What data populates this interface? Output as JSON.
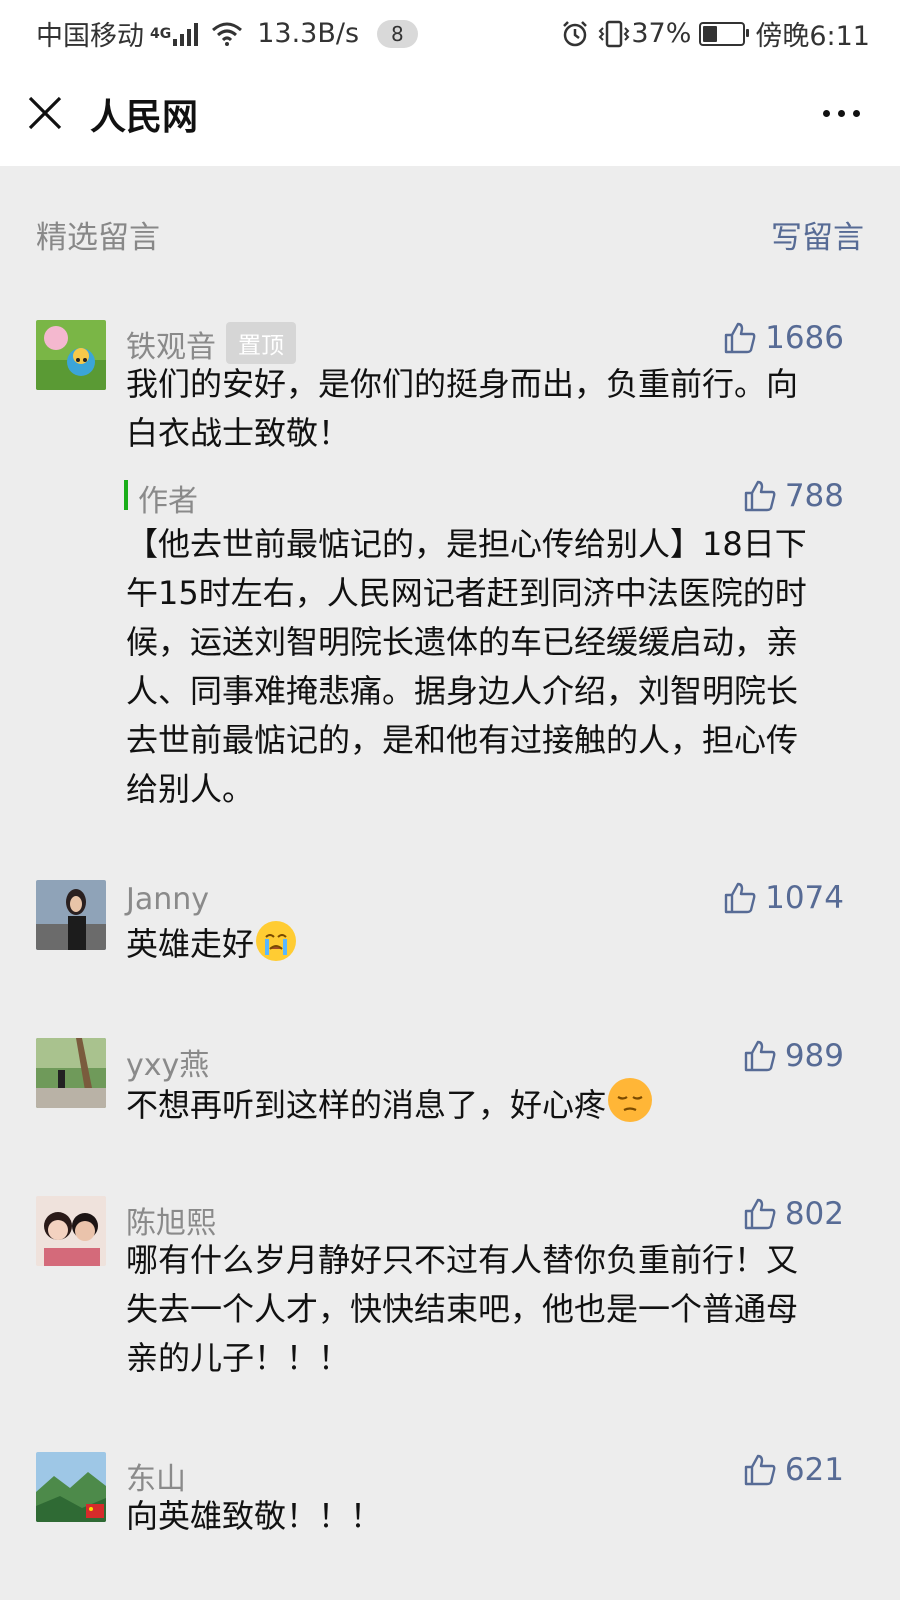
{
  "status_bar": {
    "carrier": "中国移动",
    "network": "4G",
    "speed": "13.3B/s",
    "notification_count": "8",
    "battery": "37%",
    "battery_level": 0.37,
    "time": "傍晚6:11",
    "icons": [
      "signal-icon",
      "wifi-icon",
      "alarm-icon",
      "vibrate-icon",
      "battery-icon"
    ]
  },
  "header": {
    "title": "人民网",
    "close_icon": "close-icon",
    "more_icon": "more-icon"
  },
  "section": {
    "title": "精选留言",
    "write_label": "写留言"
  },
  "comments": [
    {
      "nickname": "铁观音",
      "badge": "置顶",
      "likes": "1686",
      "text": "我们的安好，是你们的挺身而出，负重前行。向白衣战士致敬！",
      "reply": {
        "label": "作者",
        "likes": "788",
        "text": "【他去世前最惦记的，是担心传给别人】18日下午15时左右，人民网记者赶到同济中法医院的时候，运送刘智明院长遗体的车已经缓缓启动，亲人、同事难掩悲痛。据身边人介绍，刘智明院长去世前最惦记的，是和他有过接触的人，担心传给别人。"
      }
    },
    {
      "nickname": "Janny",
      "likes": "1074",
      "text": "英雄走好",
      "emoji": "crying-face"
    },
    {
      "nickname": "yxy燕",
      "likes": "989",
      "text": "不想再听到这样的消息了，好心疼",
      "emoji": "pensive-face"
    },
    {
      "nickname": "陈旭熙",
      "likes": "802",
      "text": "哪有什么岁月静好只不过有人替你负重前行！又失去一个人才，快快结束吧，他也是一个普通母亲的儿子！！！"
    },
    {
      "nickname": "东山",
      "likes": "621",
      "text": "向英雄致敬！！！"
    }
  ],
  "colors": {
    "link": "#576b95",
    "author_bar": "#1aad19",
    "background": "#ededed"
  }
}
